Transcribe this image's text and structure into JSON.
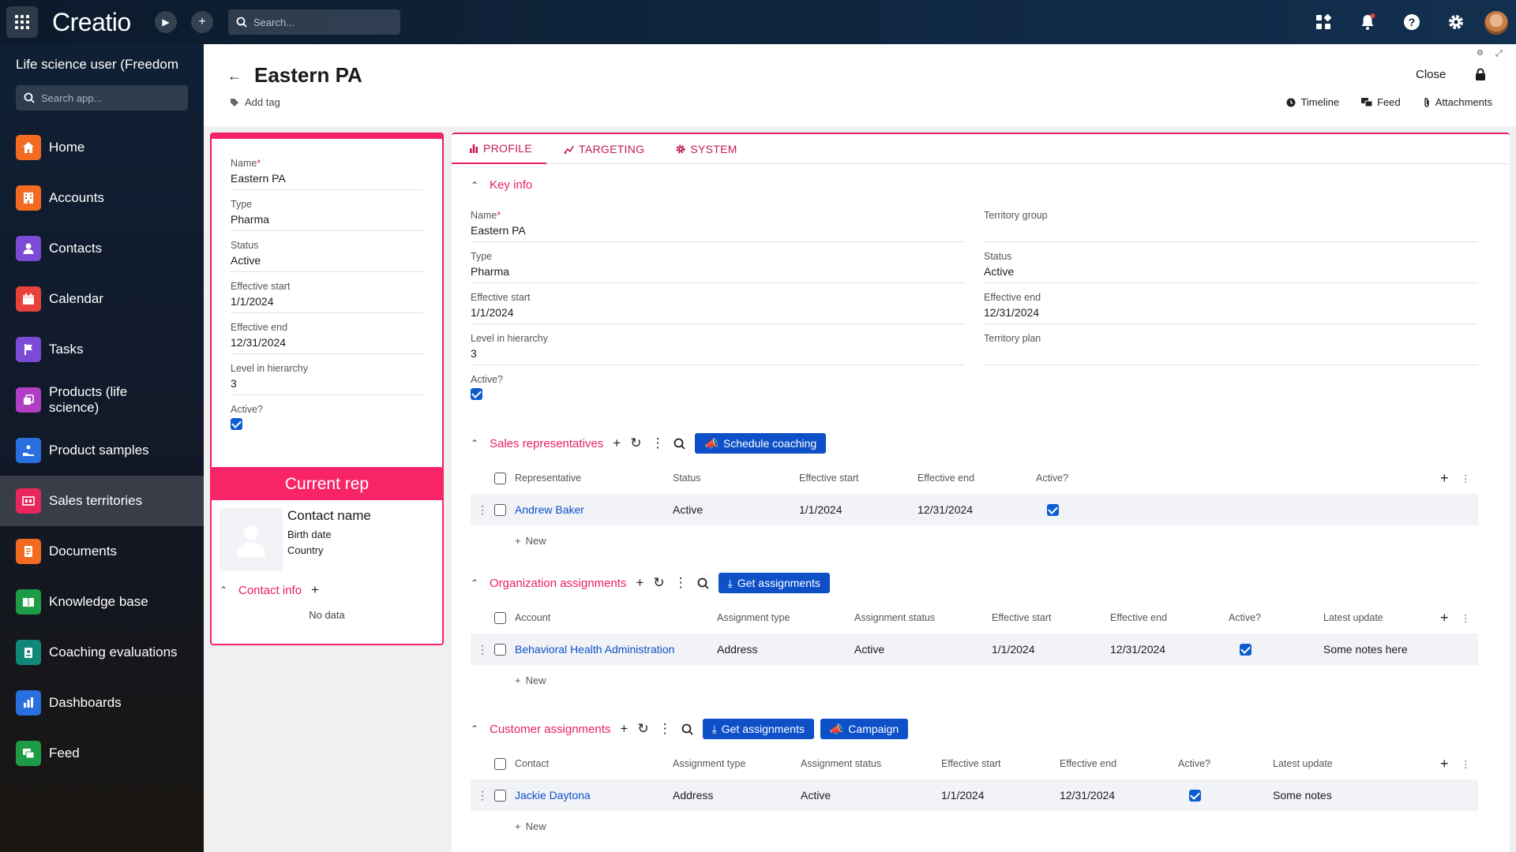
{
  "app": {
    "logo": "Creatio",
    "search_placeholder": "Search..."
  },
  "workspace": {
    "title": "Life science user (Freedom",
    "search_placeholder": "Search app..."
  },
  "nav": [
    {
      "label": "Home",
      "icon": "home-icon",
      "color": "#f26b21"
    },
    {
      "label": "Accounts",
      "icon": "building-icon",
      "color": "#f26b21"
    },
    {
      "label": "Contacts",
      "icon": "person-icon",
      "color": "#7b4bd6"
    },
    {
      "label": "Calendar",
      "icon": "calendar-icon",
      "color": "#e8423b"
    },
    {
      "label": "Tasks",
      "icon": "flag-icon",
      "color": "#7b4bd6"
    },
    {
      "label": "Products (life science)",
      "icon": "products-icon",
      "color": "#b03ec4"
    },
    {
      "label": "Product samples",
      "icon": "hand-icon",
      "color": "#2a6fe0"
    },
    {
      "label": "Sales territories",
      "icon": "territory-icon",
      "color": "#e8265e"
    },
    {
      "label": "Documents",
      "icon": "document-icon",
      "color": "#f26b21"
    },
    {
      "label": "Knowledge base",
      "icon": "book-icon",
      "color": "#1d9b45"
    },
    {
      "label": "Coaching evaluations",
      "icon": "coaching-icon",
      "color": "#11877a"
    },
    {
      "label": "Dashboards",
      "icon": "chart-icon",
      "color": "#2a6fe0"
    },
    {
      "label": "Feed",
      "icon": "chat-icon",
      "color": "#1d9b45"
    }
  ],
  "header": {
    "title": "Eastern PA",
    "add_tag": "Add tag",
    "close": "Close",
    "timeline": "Timeline",
    "feed": "Feed",
    "attachments": "Attachments"
  },
  "left_card": {
    "fields": [
      {
        "label": "Name",
        "value": "Eastern PA",
        "required": true
      },
      {
        "label": "Type",
        "value": "Pharma"
      },
      {
        "label": "Status",
        "value": "Active"
      },
      {
        "label": "Effective start",
        "value": "1/1/2024"
      },
      {
        "label": "Effective end",
        "value": "12/31/2024"
      },
      {
        "label": "Level in hierarchy",
        "value": "3"
      }
    ],
    "active_label": "Active?"
  },
  "rep_card": {
    "title": "Current rep",
    "contact_name": "Contact name",
    "birth_date": "Birth date",
    "country": "Country",
    "contact_info": "Contact info",
    "no_data": "No data"
  },
  "tabs": [
    "PROFILE",
    "TARGETING",
    "SYSTEM"
  ],
  "key_info": {
    "title": "Key info",
    "left": [
      {
        "label": "Name",
        "value": "Eastern PA",
        "required": true
      },
      {
        "label": "Type",
        "value": "Pharma"
      },
      {
        "label": "Effective start",
        "value": "1/1/2024"
      },
      {
        "label": "Level in hierarchy",
        "value": "3"
      }
    ],
    "right": [
      {
        "label": "Territory group",
        "value": ""
      },
      {
        "label": "Status",
        "value": "Active"
      },
      {
        "label": "Effective end",
        "value": "12/31/2024"
      },
      {
        "label": "Territory plan",
        "value": ""
      }
    ],
    "active_label": "Active?"
  },
  "sales_reps": {
    "title": "Sales representatives",
    "button": "Schedule coaching",
    "columns": [
      "Representative",
      "Status",
      "Effective start",
      "Effective end",
      "Active?"
    ],
    "row": {
      "representative": "Andrew Baker",
      "status": "Active",
      "start": "1/1/2024",
      "end": "12/31/2024"
    },
    "new": "New"
  },
  "org_assign": {
    "title": "Organization assignments",
    "button": "Get assignments",
    "columns": [
      "Account",
      "Assignment type",
      "Assignment status",
      "Effective start",
      "Effective end",
      "Active?",
      "Latest update"
    ],
    "row": {
      "account": "Behavioral Health Administration",
      "type": "Address",
      "status": "Active",
      "start": "1/1/2024",
      "end": "12/31/2024",
      "update": "Some notes here"
    },
    "new": "New"
  },
  "cust_assign": {
    "title": "Customer assignments",
    "button1": "Get assignments",
    "button2": "Campaign",
    "columns": [
      "Contact",
      "Assignment type",
      "Assignment status",
      "Effective start",
      "Effective end",
      "Active?",
      "Latest update"
    ],
    "row": {
      "contact": "Jackie Daytona",
      "type": "Address",
      "status": "Active",
      "start": "1/1/2024",
      "end": "12/31/2024",
      "update": "Some notes"
    },
    "new": "New"
  },
  "colors": {
    "accent": "#e81e63",
    "primary_button": "#0d50c8",
    "checkbox": "#0d5dd0"
  }
}
